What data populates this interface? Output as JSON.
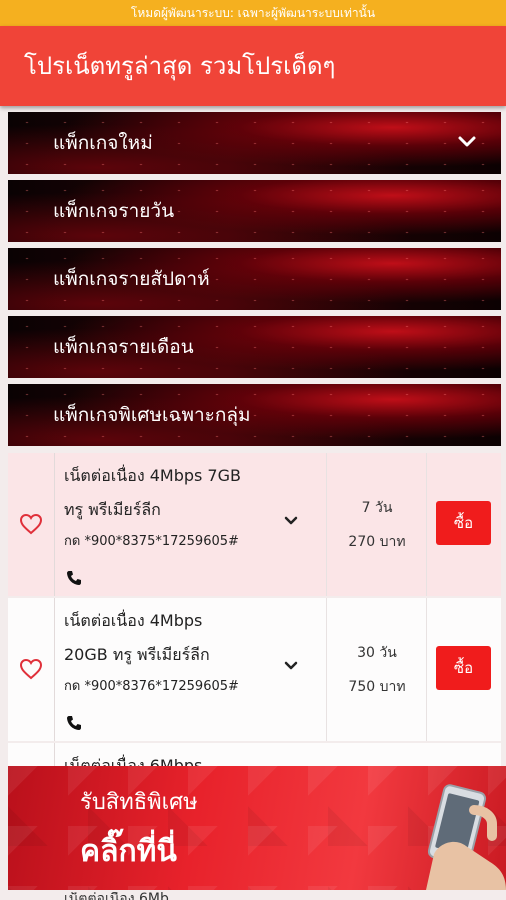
{
  "dev_banner": "โหมดผู้พัฒนาระบบ: เฉพาะผู้พัฒนาระบบเท่านั้น",
  "app_title": "โปรเน็ตทรูล่าสุด รวมโปรเด็ดๆ",
  "categories": [
    {
      "label": "แพ็กเกจใหม่",
      "icon": "chevron-down-icon"
    },
    {
      "label": "แพ็กเกจรายวัน"
    },
    {
      "label": "แพ็กเกจรายสัปดาห์"
    },
    {
      "label": "แพ็กเกจรายเดือน"
    },
    {
      "label": "แพ็กเกจพิเศษเฉพาะกลุ่ม"
    }
  ],
  "plans": [
    {
      "name_line1": "เน็ตต่อเนื่อง 4Mbps 7GB",
      "name_line2": "ทรู พรีเมียร์ลีก",
      "code": "กด *900*8375*17259605#",
      "days": "7 วัน",
      "price": "270 บาท",
      "buy_label": "ซื้อ"
    },
    {
      "name_line1": "เน็ตต่อเนื่อง 4Mbps",
      "name_line2": "20GB ทรู พรีเมียร์ลีก",
      "code": "กด *900*8376*17259605#",
      "days": "30 วัน",
      "price": "750 บาท",
      "buy_label": "ซื้อ"
    },
    {
      "name_line1": "เน็ตต่อเนื่อง 6Mbps"
    }
  ],
  "promo_banner": {
    "line1": "รับสิทธิพิเศษ",
    "line2": "คลิ๊กที่นี่"
  },
  "peek_text": "เน็ตต่อเนื่อง 6Mb",
  "colors": {
    "dev_bar": "#f5b01f",
    "app_bar": "#f04438",
    "buy_button": "#f01c1c",
    "heart": "#e0303a"
  }
}
